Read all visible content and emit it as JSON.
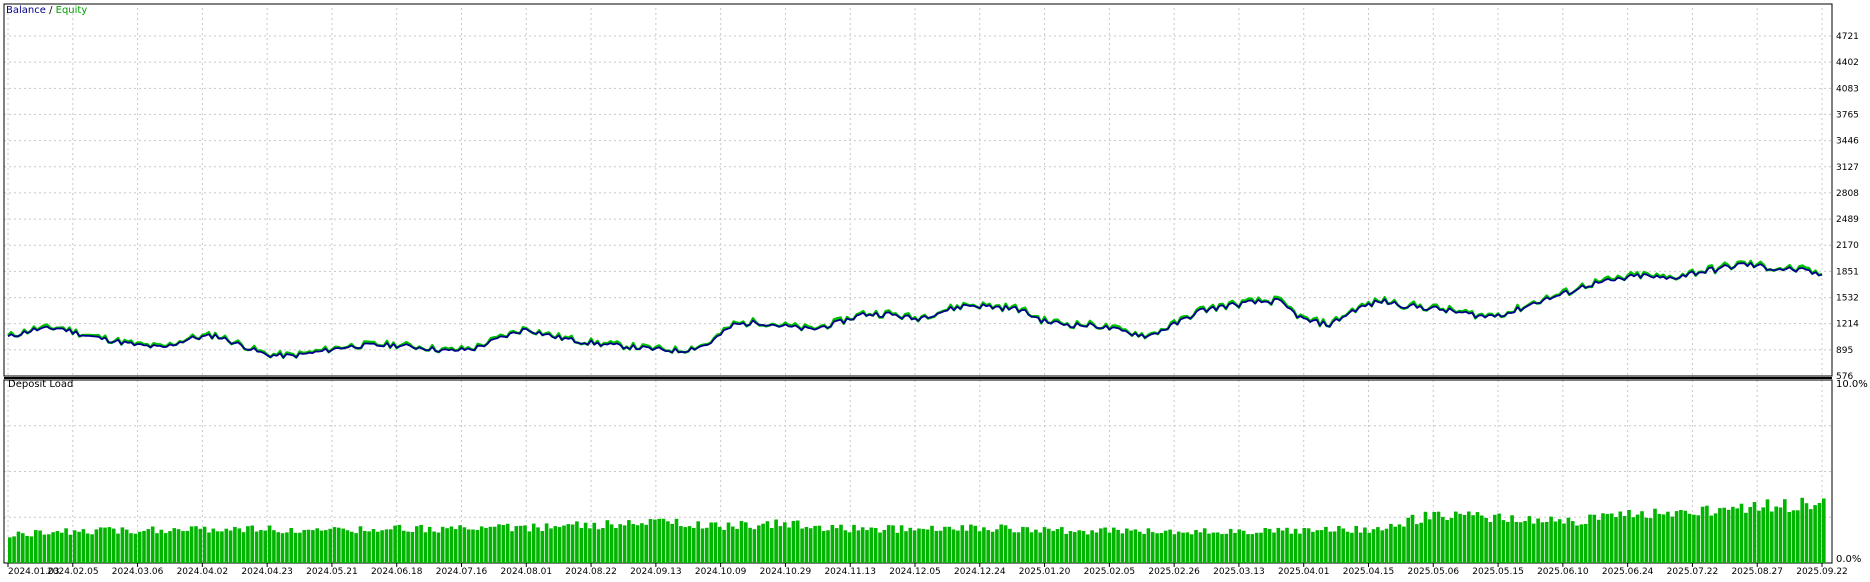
{
  "colors": {
    "background": "#ffffff",
    "grid": "#c8c8c8",
    "frame": "#000000",
    "balance": "#00008b",
    "equity": "#00c000",
    "deposit_load": "#00b400",
    "text": "#000000"
  },
  "chart_data": [
    {
      "type": "line",
      "legend": {
        "balance_label": "Balance",
        "separator": " / ",
        "equity_label": "Equity",
        "position": "top-left"
      },
      "ylim": [
        576,
        4721
      ],
      "y_ticks": [
        576,
        895,
        1214,
        1532,
        1851,
        2170,
        2489,
        2808,
        3127,
        3446,
        3765,
        4083,
        4402,
        4721
      ],
      "x_ticks": [
        "2024.01.03",
        "2024.02.05",
        "2024.03.06",
        "2024.04.02",
        "2024.04.23",
        "2024.05.21",
        "2024.06.18",
        "2024.07.16",
        "2024.08.01",
        "2024.08.22",
        "2024.09.13",
        "2024.10.09",
        "2024.10.29",
        "2024.11.13",
        "2024.12.05",
        "2024.12.24",
        "2025.01.20",
        "2025.02.05",
        "2025.02.26",
        "2025.03.13",
        "2025.04.01",
        "2025.04.15",
        "2025.05.06",
        "2025.05.15",
        "2025.06.10",
        "2025.06.24",
        "2025.07.22",
        "2025.08.27",
        "2025.09.22"
      ],
      "grid": true,
      "series": [
        {
          "name": "Balance",
          "x": [
            0,
            0.4,
            0.8,
            1.2,
            1.6,
            2.0,
            2.4,
            2.8,
            3.2,
            3.6,
            4.0,
            4.4,
            4.8,
            5.2,
            5.6,
            6.0,
            6.4,
            6.8,
            7.2,
            7.6,
            8.0,
            8.4,
            8.8,
            9.2,
            9.6,
            10.0,
            10.4,
            10.8,
            11.2,
            11.6,
            12.0,
            12.4,
            12.8,
            13.2,
            13.6,
            14.0,
            14.4,
            14.8,
            15.2,
            15.6,
            16.0,
            16.4,
            16.8,
            17.2,
            17.6,
            18.0,
            18.4,
            18.8,
            19.2,
            19.6,
            20.0,
            20.4,
            20.8,
            21.2,
            21.6,
            22.0,
            22.4,
            22.8,
            23.2,
            23.6,
            24.0,
            24.4,
            24.8,
            25.2,
            25.6,
            26.0,
            26.4,
            26.8,
            27.2,
            27.6,
            28.0
          ],
          "values": [
            1050,
            1140,
            1160,
            1070,
            1010,
            950,
            920,
            1030,
            1070,
            950,
            830,
            820,
            870,
            930,
            950,
            950,
            920,
            880,
            910,
            1040,
            1150,
            1060,
            1000,
            960,
            930,
            900,
            880,
            960,
            1200,
            1230,
            1180,
            1140,
            1220,
            1330,
            1330,
            1270,
            1360,
            1440,
            1420,
            1390,
            1240,
            1200,
            1190,
            1120,
            1060,
            1200,
            1370,
            1430,
            1470,
            1490,
            1260,
            1200,
            1390,
            1490,
            1430,
            1400,
            1350,
            1300,
            1350,
            1480,
            1570,
            1690,
            1740,
            1800,
            1760,
            1830,
            1880,
            1940,
            1890,
            1870,
            1810
          ]
        },
        {
          "name": "Equity",
          "x": [
            0,
            0.4,
            0.8,
            1.2,
            1.6,
            2.0,
            2.4,
            2.8,
            3.2,
            3.6,
            4.0,
            4.4,
            4.8,
            5.2,
            5.6,
            6.0,
            6.4,
            6.8,
            7.2,
            7.6,
            8.0,
            8.4,
            8.8,
            9.2,
            9.6,
            10.0,
            10.4,
            10.8,
            11.2,
            11.6,
            12.0,
            12.4,
            12.8,
            13.2,
            13.6,
            14.0,
            14.4,
            14.8,
            15.2,
            15.6,
            16.0,
            16.4,
            16.8,
            17.2,
            17.6,
            18.0,
            18.4,
            18.8,
            19.2,
            19.6,
            20.0,
            20.4,
            20.8,
            21.2,
            21.6,
            22.0,
            22.4,
            22.8,
            23.2,
            23.6,
            24.0,
            24.4,
            24.8,
            25.2,
            25.6,
            26.0,
            26.4,
            26.8,
            27.2,
            27.6,
            28.0
          ],
          "values": [
            1060,
            1150,
            1170,
            1080,
            1020,
            960,
            930,
            1040,
            1080,
            960,
            840,
            830,
            880,
            940,
            960,
            960,
            930,
            890,
            920,
            1050,
            1160,
            1070,
            1010,
            970,
            940,
            910,
            890,
            970,
            1210,
            1240,
            1190,
            1150,
            1230,
            1340,
            1340,
            1280,
            1370,
            1450,
            1430,
            1400,
            1250,
            1210,
            1200,
            1130,
            1070,
            1210,
            1380,
            1440,
            1480,
            1500,
            1270,
            1210,
            1400,
            1500,
            1440,
            1410,
            1360,
            1310,
            1360,
            1490,
            1580,
            1700,
            1750,
            1810,
            1770,
            1840,
            1890,
            1950,
            1900,
            1880,
            1820
          ]
        }
      ]
    },
    {
      "type": "bar",
      "title": "Deposit Load",
      "ylim": [
        0,
        10
      ],
      "y_ticks": [
        "10.0%",
        "0.0%"
      ],
      "x": [
        0,
        1,
        2,
        3,
        4,
        5,
        6,
        7,
        8,
        9,
        10,
        11,
        12,
        13,
        14,
        15,
        16,
        17,
        18,
        19,
        20,
        21,
        22,
        23,
        24,
        25,
        26,
        27,
        28
      ],
      "values": [
        1.7,
        1.9,
        1.9,
        2.0,
        2.0,
        1.9,
        2.0,
        2.0,
        2.1,
        2.2,
        2.4,
        2.2,
        2.3,
        2.0,
        2.0,
        2.1,
        1.9,
        1.9,
        1.8,
        1.9,
        1.9,
        2.0,
        2.8,
        2.6,
        2.4,
        2.9,
        3.1,
        3.3,
        3.5
      ]
    }
  ]
}
